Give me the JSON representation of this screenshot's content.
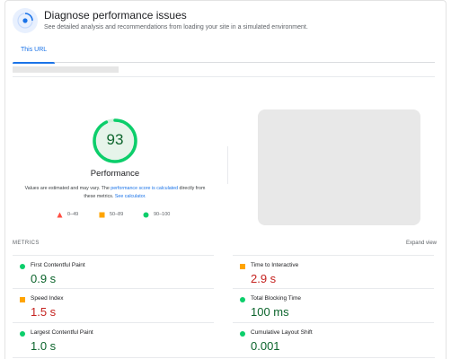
{
  "header": {
    "title": "Diagnose performance issues",
    "subtitle": "See detailed analysis and recommendations from loading your site in a simulated environment.",
    "icon": "speed-gauge-icon"
  },
  "tabs": [
    {
      "label": "This URL",
      "active": true
    }
  ],
  "score": {
    "value": "93",
    "fraction": 0.93,
    "label": "Performance",
    "color": "#0cce6b"
  },
  "note": {
    "text_before": "Values are estimated and may vary. The ",
    "link_calc": "performance score is calculated",
    "text_middle": " directly from these metrics. ",
    "link_calculator": "See calculator."
  },
  "legend": [
    {
      "shape": "triangle",
      "range": "0–49",
      "color": "#ff4e42"
    },
    {
      "shape": "square",
      "range": "50–89",
      "color": "#ffa400"
    },
    {
      "shape": "circle",
      "range": "90–100",
      "color": "#0cce6b"
    }
  ],
  "metrics_section": {
    "label": "METRICS",
    "expand_label": "Expand view"
  },
  "metrics": [
    {
      "name": "First Contentful Paint",
      "value": "0.9 s",
      "status": "good"
    },
    {
      "name": "Time to Interactive",
      "value": "2.9 s",
      "status": "average"
    },
    {
      "name": "Speed Index",
      "value": "1.5 s",
      "status": "average"
    },
    {
      "name": "Total Blocking Time",
      "value": "100 ms",
      "status": "good"
    },
    {
      "name": "Largest Contentful Paint",
      "value": "1.0 s",
      "status": "good"
    },
    {
      "name": "Cumulative Layout Shift",
      "value": "0.001",
      "status": "good"
    }
  ]
}
